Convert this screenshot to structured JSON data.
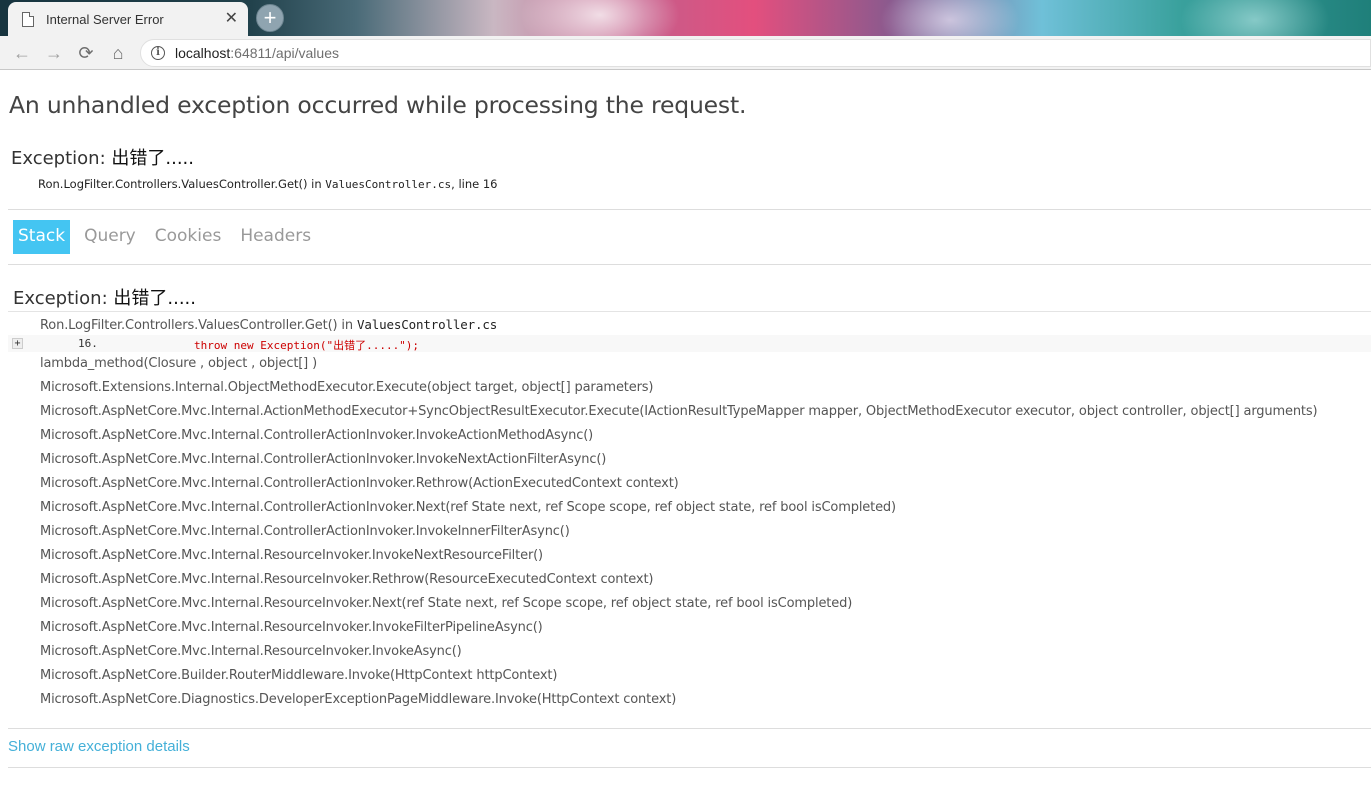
{
  "browser": {
    "tab_title": "Internal Server Error",
    "tab_close": "✕",
    "new_tab": "+",
    "url_host": "localhost",
    "url_rest": ":64811/api/values",
    "nav": {
      "back": "←",
      "forward": "→",
      "reload": "⟳",
      "home": "⌂",
      "info": "i"
    }
  },
  "page": {
    "title": "An unhandled exception occurred while processing the request.",
    "summary": {
      "label": "Exception: ",
      "message": "出错了....."
    },
    "location": {
      "method": "Ron.LogFilter.Controllers.ValuesController.Get() in ",
      "file": "ValuesController.cs",
      "line": ", line 16"
    },
    "tabs": [
      "Stack",
      "Query",
      "Cookies",
      "Headers"
    ],
    "stack": {
      "label": "Exception: ",
      "message": "出错了.....",
      "first_frame": {
        "method": "Ron.LogFilter.Controllers.ValuesController.Get() in ",
        "file": "ValuesController.cs"
      },
      "code": {
        "expander": "+",
        "line_number": "16.",
        "text": "throw new Exception(\"出错了.....\");"
      },
      "frames": [
        "lambda_method(Closure , object , object[] )",
        "Microsoft.Extensions.Internal.ObjectMethodExecutor.Execute(object target, object[] parameters)",
        "Microsoft.AspNetCore.Mvc.Internal.ActionMethodExecutor+SyncObjectResultExecutor.Execute(IActionResultTypeMapper mapper, ObjectMethodExecutor executor, object controller, object[] arguments)",
        "Microsoft.AspNetCore.Mvc.Internal.ControllerActionInvoker.InvokeActionMethodAsync()",
        "Microsoft.AspNetCore.Mvc.Internal.ControllerActionInvoker.InvokeNextActionFilterAsync()",
        "Microsoft.AspNetCore.Mvc.Internal.ControllerActionInvoker.Rethrow(ActionExecutedContext context)",
        "Microsoft.AspNetCore.Mvc.Internal.ControllerActionInvoker.Next(ref State next, ref Scope scope, ref object state, ref bool isCompleted)",
        "Microsoft.AspNetCore.Mvc.Internal.ControllerActionInvoker.InvokeInnerFilterAsync()",
        "Microsoft.AspNetCore.Mvc.Internal.ResourceInvoker.InvokeNextResourceFilter()",
        "Microsoft.AspNetCore.Mvc.Internal.ResourceInvoker.Rethrow(ResourceExecutedContext context)",
        "Microsoft.AspNetCore.Mvc.Internal.ResourceInvoker.Next(ref State next, ref Scope scope, ref object state, ref bool isCompleted)",
        "Microsoft.AspNetCore.Mvc.Internal.ResourceInvoker.InvokeFilterPipelineAsync()",
        "Microsoft.AspNetCore.Mvc.Internal.ResourceInvoker.InvokeAsync()",
        "Microsoft.AspNetCore.Builder.RouterMiddleware.Invoke(HttpContext httpContext)",
        "Microsoft.AspNetCore.Diagnostics.DeveloperExceptionPageMiddleware.Invoke(HttpContext context)"
      ]
    },
    "raw_link": "Show raw exception details"
  }
}
